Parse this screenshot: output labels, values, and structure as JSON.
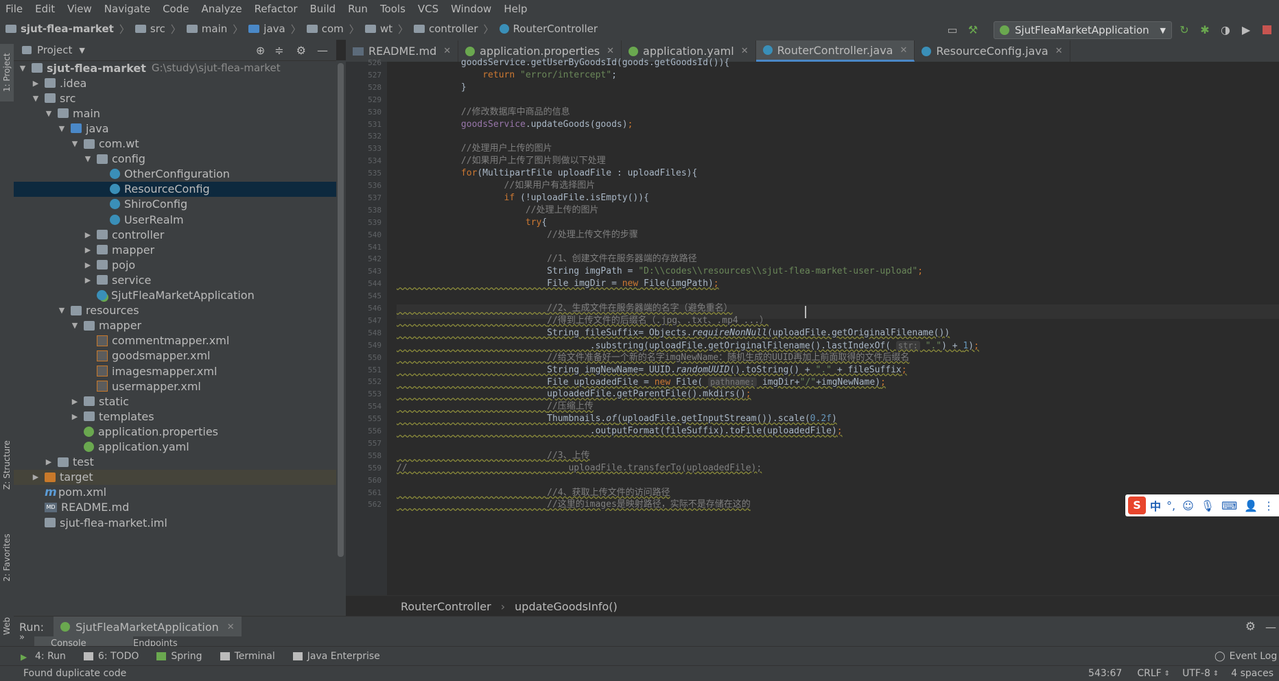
{
  "menu": [
    "File",
    "Edit",
    "View",
    "Navigate",
    "Code",
    "Analyze",
    "Refactor",
    "Build",
    "Run",
    "Tools",
    "VCS",
    "Window",
    "Help"
  ],
  "breadcrumb": [
    "sjut-flea-market",
    "src",
    "main",
    "java",
    "com",
    "wt",
    "controller",
    "RouterController"
  ],
  "run_config": "SjutFleaMarketApplication",
  "side_labels": {
    "project": "1: Project",
    "structure": "Z: Structure",
    "favorites": "2: Favorites",
    "web": "Web"
  },
  "project_panel": {
    "title": "Project",
    "tree": [
      {
        "label": "sjut-flea-market",
        "suffix": "G:\\study\\sjut-flea-market",
        "indent": 0,
        "arrow": "down",
        "icon": "folder"
      },
      {
        "label": ".idea",
        "indent": 1,
        "arrow": "right",
        "icon": "folder"
      },
      {
        "label": "src",
        "indent": 1,
        "arrow": "down",
        "icon": "folder"
      },
      {
        "label": "main",
        "indent": 2,
        "arrow": "down",
        "icon": "folder"
      },
      {
        "label": "java",
        "indent": 3,
        "arrow": "down",
        "icon": "folder-src"
      },
      {
        "label": "com.wt",
        "indent": 4,
        "arrow": "down",
        "icon": "pkg"
      },
      {
        "label": "config",
        "indent": 5,
        "arrow": "down",
        "icon": "pkg"
      },
      {
        "label": "OtherConfiguration",
        "indent": 6,
        "arrow": "",
        "icon": "cls"
      },
      {
        "label": "ResourceConfig",
        "indent": 6,
        "arrow": "",
        "icon": "cls",
        "selected": true
      },
      {
        "label": "ShiroConfig",
        "indent": 6,
        "arrow": "",
        "icon": "cls"
      },
      {
        "label": "UserRealm",
        "indent": 6,
        "arrow": "",
        "icon": "cls"
      },
      {
        "label": "controller",
        "indent": 5,
        "arrow": "right",
        "icon": "pkg"
      },
      {
        "label": "mapper",
        "indent": 5,
        "arrow": "right",
        "icon": "pkg"
      },
      {
        "label": "pojo",
        "indent": 5,
        "arrow": "right",
        "icon": "pkg"
      },
      {
        "label": "service",
        "indent": 5,
        "arrow": "right",
        "icon": "pkg"
      },
      {
        "label": "SjutFleaMarketApplication",
        "indent": 5,
        "arrow": "",
        "icon": "spring-cls"
      },
      {
        "label": "resources",
        "indent": 3,
        "arrow": "down",
        "icon": "folder-res"
      },
      {
        "label": "mapper",
        "indent": 4,
        "arrow": "down",
        "icon": "folder"
      },
      {
        "label": "commentmapper.xml",
        "indent": 5,
        "arrow": "",
        "icon": "xml"
      },
      {
        "label": "goodsmapper.xml",
        "indent": 5,
        "arrow": "",
        "icon": "xml"
      },
      {
        "label": "imagesmapper.xml",
        "indent": 5,
        "arrow": "",
        "icon": "xml"
      },
      {
        "label": "usermapper.xml",
        "indent": 5,
        "arrow": "",
        "icon": "xml"
      },
      {
        "label": "static",
        "indent": 4,
        "arrow": "right",
        "icon": "folder"
      },
      {
        "label": "templates",
        "indent": 4,
        "arrow": "right",
        "icon": "folder"
      },
      {
        "label": "application.properties",
        "indent": 4,
        "arrow": "",
        "icon": "spring"
      },
      {
        "label": "application.yaml",
        "indent": 4,
        "arrow": "",
        "icon": "spring"
      },
      {
        "label": "test",
        "indent": 2,
        "arrow": "right",
        "icon": "folder"
      },
      {
        "label": "target",
        "indent": 1,
        "arrow": "right",
        "icon": "folder-orange",
        "highlight": true
      },
      {
        "label": "pom.xml",
        "indent": 1,
        "arrow": "",
        "icon": "m"
      },
      {
        "label": "README.md",
        "indent": 1,
        "arrow": "",
        "icon": "md"
      },
      {
        "label": "sjut-flea-market.iml",
        "indent": 1,
        "arrow": "",
        "icon": "iml"
      }
    ]
  },
  "tabs": [
    {
      "label": "README.md",
      "icon": "md"
    },
    {
      "label": "application.properties",
      "icon": "spring"
    },
    {
      "label": "application.yaml",
      "icon": "spring"
    },
    {
      "label": "RouterController.java",
      "icon": "cls",
      "active": true
    },
    {
      "label": "ResourceConfig.java",
      "icon": "cls"
    }
  ],
  "code_lines": [
    {
      "n": "526",
      "html": "            <span>goodsService.getUserByGoodsId(goods.getGoodsId()){</span>"
    },
    {
      "n": "527",
      "html": "                <span class='kw'>return</span> <span class='str'>\"error/intercept\"</span>;"
    },
    {
      "n": "528",
      "html": "            }"
    },
    {
      "n": "529",
      "html": ""
    },
    {
      "n": "530",
      "html": "            <span style='color:#808080'>//修改数据库中商品的信息</span>"
    },
    {
      "n": "531",
      "html": "            <span class='fld'>goodsService</span>.updateGoods(goods)<span class='kw'>;</span>"
    },
    {
      "n": "532",
      "html": ""
    },
    {
      "n": "533",
      "html": "            <span style='color:#808080'>//处理用户上传的图片</span>"
    },
    {
      "n": "534",
      "html": "            <span style='color:#808080'>//如果用户上传了图片则做以下处理</span>"
    },
    {
      "n": "535",
      "html": "            <span class='kw'>for</span>(MultipartFile uploadFile : uploadFiles){"
    },
    {
      "n": "536",
      "html": "                    <span style='color:#808080'>//如果用户有选择图片</span>"
    },
    {
      "n": "537",
      "html": "                    <span class='kw'>if</span> (!uploadFile.isEmpty()){"
    },
    {
      "n": "538",
      "html": "                        <span style='color:#808080'>//处理上传的图片</span>"
    },
    {
      "n": "539",
      "html": "                        <span class='kw'>try</span>{"
    },
    {
      "n": "540",
      "html": "                            <span style='color:#808080'>//处理上传文件的步骤</span>"
    },
    {
      "n": "541",
      "html": ""
    },
    {
      "n": "542",
      "html": "                            <span style='color:#808080'>//1、创建文件在服务器端的存放路径</span>"
    },
    {
      "n": "543",
      "html": "                            String imgPath = <span class='str'>\"D:\\\\codes\\\\resources\\\\sjut-flea-market-user-upload\"</span><span class='kw'>;</span>"
    },
    {
      "n": "544",
      "html": "                            File imgDir = <span class='kw'>new</span> File(imgPath)<span class='kw'>;</span>"
    },
    {
      "n": "545",
      "html": ""
    },
    {
      "n": "546",
      "html": "                            <span style='color:#808080'>//2、生成文件在服务器端的名字（避免重名）</span>"
    },
    {
      "n": "547",
      "html": "                            <span style='color:#808080'>//得到上传文件的后缀名（.jpg、.txt、.mp4 ...）</span>"
    },
    {
      "n": "548",
      "html": "                            String fileSuffix= Objects.<span class='it'>requireNonNull</span>(uploadFile.getOriginalFilename())"
    },
    {
      "n": "549",
      "html": "                                    .substring(uploadFile.getOriginalFilename().lastIndexOf( <span class='hint'>str:</span> <span class='str'>\".\"</span>) + <span class='num'>1</span>)<span class='kw'>;</span>"
    },
    {
      "n": "550",
      "html": "                            <span style='color:#808080'>//给文件准备好一个新的名字imgNewName：随机生成的UUID再加上前面取得的文件后缀名</span>"
    },
    {
      "n": "551",
      "html": "                            String imgNewName= UUID.<span class='it'>randomUUID</span>().toString() + <span class='str'>\".\"</span> + fileSuffix<span class='kw'>;</span>"
    },
    {
      "n": "552",
      "html": "                            File uploadedFile = <span class='kw'>new</span> File( <span class='hint'>pathname:</span> imgDir+<span class='str'>\"/\"</span>+imgNewName)<span class='kw'>;</span>"
    },
    {
      "n": "553",
      "html": "                            uploadedFile.getParentFile().mkdirs()<span class='kw'>;</span>"
    },
    {
      "n": "554",
      "html": "                            <span style='color:#808080'>//压缩上传</span>"
    },
    {
      "n": "555",
      "html": "                            Thumbnails.<span class='it'>of</span>(uploadFile.getInputStream()).scale(<span class='num'>0.2f</span>)"
    },
    {
      "n": "556",
      "html": "                                    .outputFormat(fileSuffix).toFile(uploadedFile)<span class='kw'>;</span>"
    },
    {
      "n": "557",
      "html": ""
    },
    {
      "n": "558",
      "html": "                            <span style='color:#808080'>//3、上传</span>"
    },
    {
      "n": "559",
      "html": "<span style='color:#808080'>//                              uploadFile.transferTo(uploadedFile);</span>"
    },
    {
      "n": "560",
      "html": ""
    },
    {
      "n": "561",
      "html": "                            <span style='color:#808080'>//4、获取上传文件的访问路径</span>"
    },
    {
      "n": "562",
      "html": "                            <span style='color:#808080'>//这里的images是映射路径，实际不是存储在这的</span>"
    }
  ],
  "editor_breadcrumb": [
    "RouterController",
    "updateGoodsInfo()"
  ],
  "run_panel": {
    "label": "Run:",
    "config": "SjutFleaMarketApplication",
    "subtabs": [
      "Console",
      "Endpoints"
    ]
  },
  "bottom_tabs": [
    {
      "label": "4: Run",
      "icon": "run"
    },
    {
      "label": "6: TODO",
      "icon": "todo"
    },
    {
      "label": "Spring",
      "icon": "spring"
    },
    {
      "label": "Terminal",
      "icon": "terminal"
    },
    {
      "label": "Java Enterprise",
      "icon": "je"
    }
  ],
  "event_log": "Event Log",
  "status": {
    "message": "Found duplicate code",
    "position": "543:67",
    "line_sep": "CRLF",
    "encoding": "UTF-8",
    "indent": "4 spaces"
  },
  "ime": {
    "lang": "中",
    "punct": "°,"
  }
}
